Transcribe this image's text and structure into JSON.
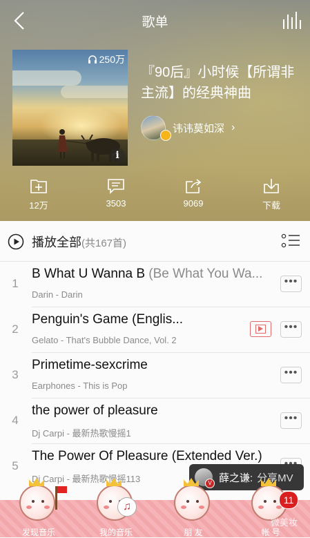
{
  "header": {
    "title": "歌单",
    "back_icon": "chevron-left-icon",
    "equalizer_icon": "equalizer-icon"
  },
  "playlist": {
    "play_count": "250万",
    "name": "『90后』小时候【所谓非主流】的经典神曲",
    "creator": "讳讳莫如深",
    "info_symbol": "i"
  },
  "actions": [
    {
      "label": "12万",
      "icon": "add-folder-icon"
    },
    {
      "label": "3503",
      "icon": "comment-icon"
    },
    {
      "label": "9069",
      "icon": "share-icon"
    },
    {
      "label": "下载",
      "icon": "download-icon"
    }
  ],
  "play_all": {
    "label": "播放全部",
    "count": "(共167首)"
  },
  "songs": [
    {
      "index": "1",
      "title": "B What U Wanna B",
      "alias": " (Be What You Wa...",
      "meta": "Darin - Darin",
      "more": "•••",
      "has_mv": false
    },
    {
      "index": "2",
      "title": "Penguin's Game (Englis...",
      "alias": "",
      "meta": "Gelato - That's Bubble Dance, Vol. 2",
      "more": "•••",
      "has_mv": true
    },
    {
      "index": "3",
      "title": "Primetime-sexcrime",
      "alias": "",
      "meta": "Earphones - This is Pop",
      "more": "•••",
      "has_mv": false
    },
    {
      "index": "4",
      "title": "the power of pleasure",
      "alias": "",
      "meta": "Dj Carpi - 最新热歌慢摇1",
      "more": "•••",
      "has_mv": false
    },
    {
      "index": "5",
      "title": "The Power Of Pleasure (Extended Ver.)",
      "alias": "",
      "meta": "Dj Carpi - 最新热歌慢摇113",
      "more": "•••",
      "has_mv": false
    }
  ],
  "toast": {
    "name": "薛之谦:",
    "action": "分享MV",
    "badge": "V"
  },
  "tabs": [
    {
      "label": "发现音乐"
    },
    {
      "label": "我的音乐"
    },
    {
      "label": "朋 友"
    },
    {
      "label": "帐 号"
    }
  ],
  "account_badge": "11",
  "note_symbol": "♫",
  "watermark": "微美妆",
  "colors": {
    "accent_red": "#d91f1f",
    "tabbar_pink": "#f6b4b8"
  }
}
